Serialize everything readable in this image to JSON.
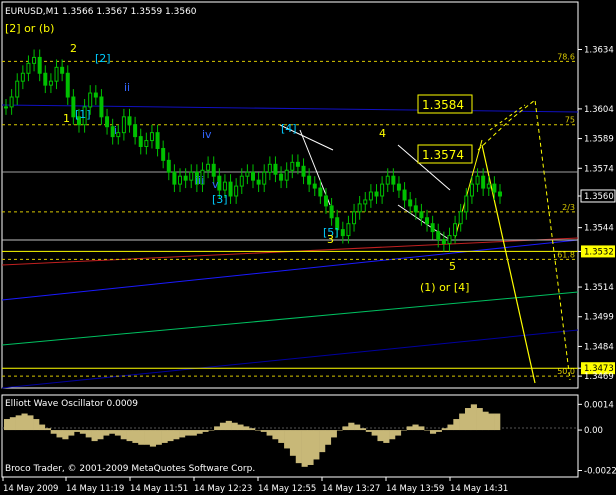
{
  "header": {
    "symbol_line": "EURUSD,M1  1.3566 1.3567 1.3559 1.3560"
  },
  "oscillator": {
    "title": "Elliott Wave Oscillator 0.0009"
  },
  "footer": {
    "copyright": "Broco Trader, © 2001-2009 MetaQuotes Software Corp."
  },
  "chart_data": [
    {
      "type": "candlestick",
      "title": "EURUSD,M1  1.3566 1.3567 1.3559 1.3560",
      "ylim": [
        1.3463,
        1.3658
      ],
      "y_ticks": [
        "1.3634",
        "1.3604",
        "1.3589",
        "1.3574",
        "1.3560",
        "1.3544",
        "1.3532",
        "1.3514",
        "1.3499",
        "1.3484",
        "1.3473",
        "1.3469"
      ],
      "x_ticks": [
        "14 May 2009",
        "14 May 11:19",
        "14 May 11:51",
        "14 May 12:23",
        "14 May 12:55",
        "14 May 13:27",
        "14 May 13:59",
        "14 May 14:31"
      ],
      "price_path": [
        1.3605,
        1.361,
        1.3618,
        1.3622,
        1.3627,
        1.363,
        1.3622,
        1.3616,
        1.3618,
        1.3625,
        1.3622,
        1.361,
        1.36,
        1.3596,
        1.3605,
        1.3612,
        1.361,
        1.36,
        1.3595,
        1.359,
        1.3592,
        1.36,
        1.3596,
        1.359,
        1.3585,
        1.3588,
        1.3592,
        1.3584,
        1.3578,
        1.3572,
        1.3566,
        1.357,
        1.3568,
        1.3572,
        1.3566,
        1.3573,
        1.3576,
        1.357,
        1.3563,
        1.3567,
        1.356,
        1.3565,
        1.357,
        1.3572,
        1.3568,
        1.3566,
        1.3572,
        1.3576,
        1.3571,
        1.3568,
        1.3573,
        1.3577,
        1.3575,
        1.357,
        1.3566,
        1.3564,
        1.356,
        1.3555,
        1.3549,
        1.3543,
        1.354,
        1.3546,
        1.3552,
        1.3556,
        1.3558,
        1.3562,
        1.356,
        1.3566,
        1.357,
        1.3566,
        1.3563,
        1.3558,
        1.3555,
        1.3552,
        1.3549,
        1.3546,
        1.3542,
        1.3538,
        1.3536,
        1.354,
        1.3546,
        1.3552,
        1.356,
        1.3566,
        1.357,
        1.3564,
        1.3566,
        1.3562,
        1.356
      ],
      "last_price": "1.3560",
      "horizontal_lines": [
        {
          "label": "78.6",
          "price": 1.3628,
          "style": "dashed",
          "color": "#d8c800"
        },
        {
          "label": "75",
          "price": 1.3596,
          "style": "dashed",
          "color": "#d8c800"
        },
        {
          "label": "2/3",
          "price": 1.3552,
          "style": "dashed",
          "color": "#d8c800"
        },
        {
          "label": "61.8",
          "price": 1.3528,
          "style": "dashed",
          "color": "#d8c800"
        },
        {
          "label": "50.0",
          "price": 1.3469,
          "style": "dashed",
          "color": "#d8c800"
        },
        {
          "label": "1.3532",
          "price": 1.3532,
          "style": "solid",
          "color": "#ffff00"
        },
        {
          "label": "1.3473",
          "price": 1.3473,
          "style": "solid",
          "color": "#ffff00"
        }
      ],
      "boxed_labels": [
        "1.3584",
        "1.3574"
      ],
      "wave_labels": [
        {
          "text": "[2] or (b)",
          "color": "#ffff00"
        },
        {
          "text": "2",
          "color": "#ffff00"
        },
        {
          "text": "1",
          "color": "#ffff00"
        },
        {
          "text": "[1]",
          "color": "#00ccff"
        },
        {
          "text": "[2]",
          "color": "#00ccff"
        },
        {
          "text": "ii",
          "color": "#3366ff"
        },
        {
          "text": "i",
          "color": "#3366ff"
        },
        {
          "text": "iv",
          "color": "#3366ff"
        },
        {
          "text": "iii",
          "color": "#3366ff"
        },
        {
          "text": "v",
          "color": "#3366ff"
        },
        {
          "text": "[3]",
          "color": "#00ccff"
        },
        {
          "text": "[4]",
          "color": "#00ccff"
        },
        {
          "text": "4",
          "color": "#ffff00"
        },
        {
          "text": "[5]",
          "color": "#00ccff"
        },
        {
          "text": "3",
          "color": "#ffff00"
        },
        {
          "text": "5",
          "color": "#ffff00"
        },
        {
          "text": "(1) or [4]",
          "color": "#ffff00"
        }
      ]
    },
    {
      "type": "bar",
      "title": "Elliott Wave Oscillator 0.0009",
      "ylim": [
        -0.0025,
        0.0018
      ],
      "y_ticks": [
        "0.0014",
        "0.00",
        "-0.0022"
      ],
      "values": [
        0.0006,
        0.0007,
        0.0008,
        0.0009,
        0.0008,
        0.0006,
        0.0003,
        0.0001,
        -0.0002,
        -0.0004,
        -0.0005,
        -0.0003,
        -0.0001,
        -0.0002,
        -0.0004,
        -0.0006,
        -0.0005,
        -0.0003,
        -0.0002,
        -0.0003,
        -0.0005,
        -0.0006,
        -0.0007,
        -0.0008,
        -0.0008,
        -0.0009,
        -0.0008,
        -0.0007,
        -0.0006,
        -0.0005,
        -0.0004,
        -0.0003,
        -0.0003,
        -0.0002,
        -0.0001,
        0.0,
        0.0002,
        0.0004,
        0.0005,
        0.0004,
        0.0003,
        0.0002,
        0.0001,
        0.0,
        -0.0001,
        -0.0003,
        -0.0005,
        -0.0007,
        -0.001,
        -0.0014,
        -0.0018,
        -0.002,
        -0.0019,
        -0.0016,
        -0.0012,
        -0.0008,
        -0.0004,
        0.0,
        0.0002,
        0.0004,
        0.0003,
        0.0001,
        -0.0001,
        -0.0003,
        -0.0006,
        -0.0007,
        -0.0005,
        -0.0003,
        0.0,
        0.0002,
        0.0003,
        0.0002,
        0.0,
        -0.0002,
        -0.0001,
        0.0001,
        0.0003,
        0.0006,
        0.0009,
        0.0012,
        0.0014,
        0.0012,
        0.001,
        0.0009,
        0.0009
      ]
    }
  ]
}
